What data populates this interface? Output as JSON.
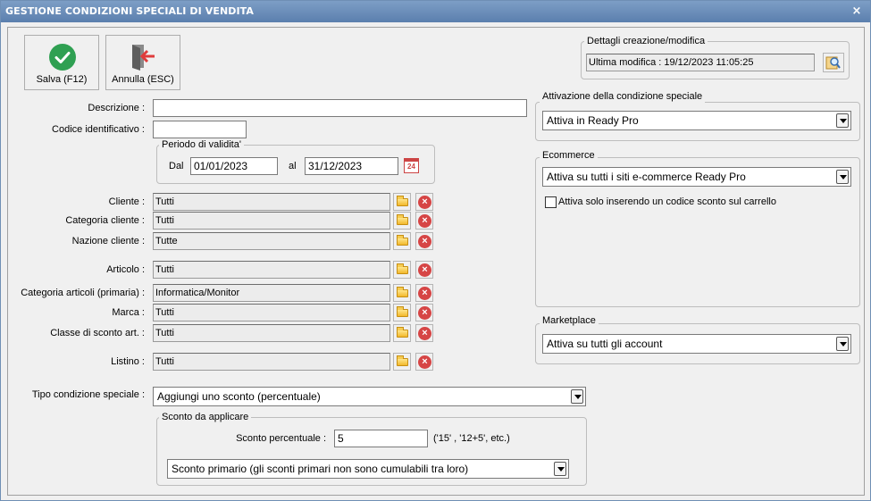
{
  "window": {
    "title": "GESTIONE CONDIZIONI SPECIALI DI VENDITA",
    "close_glyph": "×"
  },
  "toolbar": {
    "save_label": "Salva (F12)",
    "cancel_label": "Annulla (ESC)",
    "save_icon": "check-circle-icon",
    "cancel_icon": "exit-door-icon"
  },
  "form": {
    "descrizione_label": "Descrizione :",
    "descrizione_value": "",
    "codice_label": "Codice identificativo :",
    "codice_value": "",
    "periodo": {
      "title": "Periodo di validita'",
      "dal_label": "Dal",
      "dal_value": "01/01/2023",
      "al_label": "al",
      "al_value": "31/12/2023",
      "calendar_day": "24"
    },
    "filters": [
      {
        "label": "Cliente :",
        "value": "Tutti"
      },
      {
        "label": "Categoria cliente :",
        "value": "Tutti"
      },
      {
        "label": "Nazione cliente :",
        "value": "Tutte"
      },
      {
        "label": "Articolo :",
        "value": "Tutti"
      },
      {
        "label": "Categoria articoli (primaria) :",
        "value": "Informatica/Monitor"
      },
      {
        "label": "Marca :",
        "value": "Tutti"
      },
      {
        "label": "Classe di sconto art. :",
        "value": "Tutti"
      },
      {
        "label": "Listino :",
        "value": "Tutti"
      }
    ],
    "tipo_label": "Tipo condizione speciale :",
    "tipo_value": "Aggiungi uno sconto (percentuale)",
    "sconto": {
      "title": "Sconto da applicare",
      "perc_label": "Sconto percentuale :",
      "perc_value": "5",
      "hint": "('15' , '12+5', etc.)",
      "tipo_sconto_value": "Sconto primario (gli sconti primari non sono cumulabili tra loro)"
    }
  },
  "right": {
    "dettagli": {
      "title": "Dettagli creazione/modifica",
      "value": "Ultima modifica : 19/12/2023  11:05:25",
      "search_icon": "magnifier-icon"
    },
    "attivazione": {
      "title": "Attivazione della condizione speciale",
      "value": "Attiva in Ready Pro"
    },
    "ecommerce": {
      "title": "Ecommerce",
      "value": "Attiva su tutti i siti e-commerce Ready Pro",
      "checkbox_label": "Attiva solo inserendo un codice sconto sul carrello",
      "checkbox_checked": false
    },
    "marketplace": {
      "title": "Marketplace",
      "value": "Attiva su tutti gli account"
    }
  }
}
